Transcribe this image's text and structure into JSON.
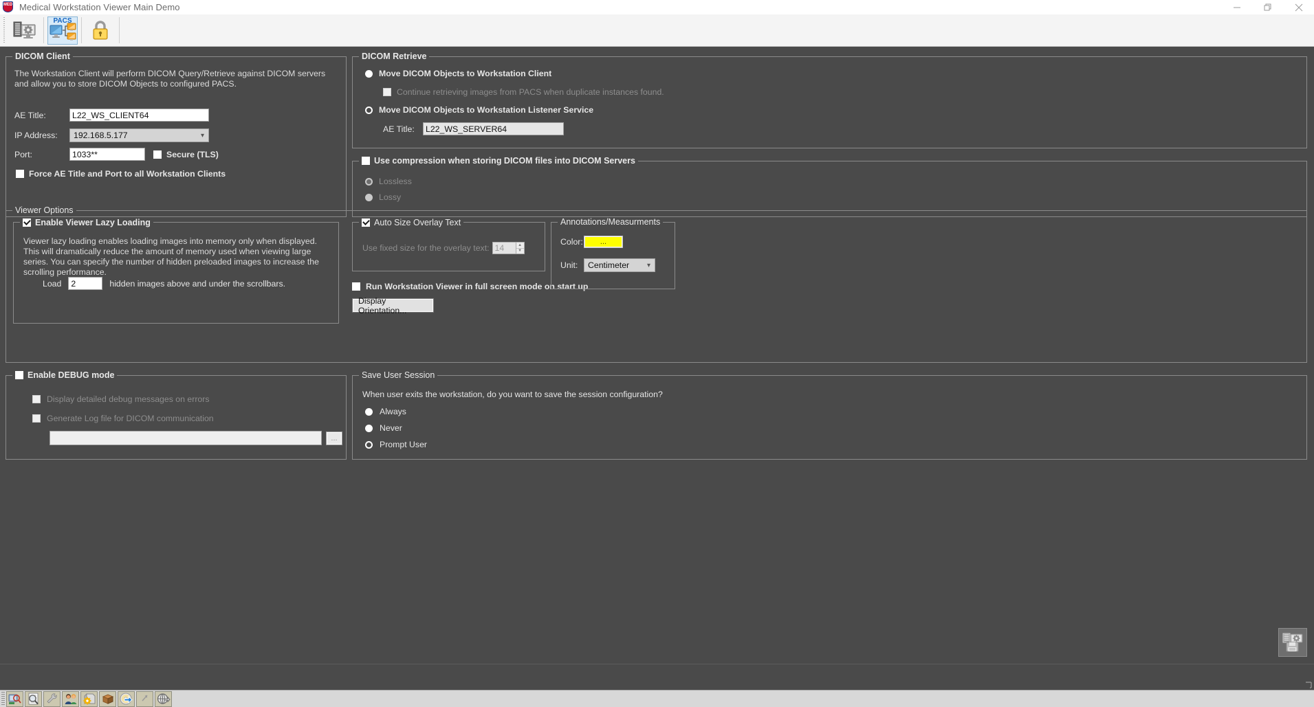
{
  "window": {
    "title": "Medical Workstation Viewer Main Demo",
    "app_icon": "med-shield-icon",
    "controls": {
      "minimize": "minimize-icon",
      "restore": "restore-icon",
      "close": "close-icon"
    }
  },
  "toolbar": {
    "buttons": [
      {
        "name": "server-settings-icon",
        "label": "",
        "active": false
      },
      {
        "name": "pacs-network-icon",
        "label": "PACS",
        "active": true
      },
      {
        "name": "security-lock-icon",
        "label": "",
        "active": false
      }
    ]
  },
  "dicom_client": {
    "legend": "DICOM Client",
    "description": "The Workstation Client will perform DICOM Query/Retrieve against DICOM servers and allow you to store DICOM Objects to configured PACS.",
    "ae_title_label": "AE Title:",
    "ae_title_value": "L22_WS_CLIENT64",
    "ip_label": "IP Address:",
    "ip_value": "192.168.5.177",
    "port_label": "Port:",
    "port_value": "1033**",
    "secure_tls_label": "Secure (TLS)",
    "secure_tls_checked": false,
    "force_label": "Force AE Title and Port to all Workstation Clients",
    "force_checked": false
  },
  "dicom_retrieve": {
    "legend": "DICOM Retrieve",
    "option_client_label": "Move DICOM Objects to Workstation Client",
    "option_client_selected": false,
    "continue_label": "Continue retrieving images from PACS when duplicate instances found.",
    "continue_checked": false,
    "continue_disabled": true,
    "option_listener_label": "Move DICOM Objects to Workstation Listener Service",
    "option_listener_selected": true,
    "listener_ae_label": "AE Title:",
    "listener_ae_value": "L22_WS_SERVER64"
  },
  "compression": {
    "legend": "Use compression when storing DICOM files into DICOM Servers",
    "enabled": false,
    "options": [
      {
        "label": "Lossless",
        "selected": true
      },
      {
        "label": "Lossy",
        "selected": false
      }
    ]
  },
  "viewer_options": {
    "legend": "Viewer Options",
    "lazy_loading": {
      "legend": "Enable Viewer Lazy Loading",
      "checked": true,
      "description": "Viewer lazy loading enables loading images into memory only when displayed. This will dramatically reduce the amount of memory used when viewing large series. You can specify the number of hidden preloaded images to increase the scrolling performance.",
      "load_prefix": "Load",
      "load_value": "2",
      "load_suffix": "hidden images above and under the scrollbars."
    },
    "overlay": {
      "legend": "Auto Size Overlay Text",
      "checked": true,
      "fixed_size_label": "Use fixed size for the overlay text:",
      "fixed_size_value": "14"
    },
    "fullscreen_label": "Run Workstation Viewer in full screen mode on start up",
    "fullscreen_checked": false,
    "display_orientation_button": "Display Orientation...",
    "annotations": {
      "legend": "Annotations/Measurments",
      "color_label": "Color:",
      "color_value": "#FFFF00",
      "color_button_text": "...",
      "unit_label": "Unit:",
      "unit_value": "Centimeter"
    }
  },
  "debug": {
    "legend": "Enable DEBUG mode",
    "checked": false,
    "detailed_label": "Display detailed debug messages on errors",
    "detailed_checked": false,
    "logfile_label": "Generate Log file for DICOM communication",
    "logfile_checked": false,
    "logfile_path": "",
    "browse_button": "..."
  },
  "save_session": {
    "legend": "Save User Session",
    "question": "When user exits the workstation, do you want to save the session configuration?",
    "options": [
      {
        "label": "Always",
        "selected": false
      },
      {
        "label": "Never",
        "selected": false
      },
      {
        "label": "Prompt User",
        "selected": true
      }
    ]
  },
  "apply_button": {
    "name": "save-settings-button"
  },
  "bottom_toolbar": {
    "buttons": [
      "study-search-icon",
      "magnifier-document-icon",
      "wrench-tools-icon",
      "users-icon",
      "server-settings-icon",
      "archive-box-icon",
      "cd-export-icon",
      "arrow-pointer-icon",
      "globe-export-icon"
    ]
  }
}
